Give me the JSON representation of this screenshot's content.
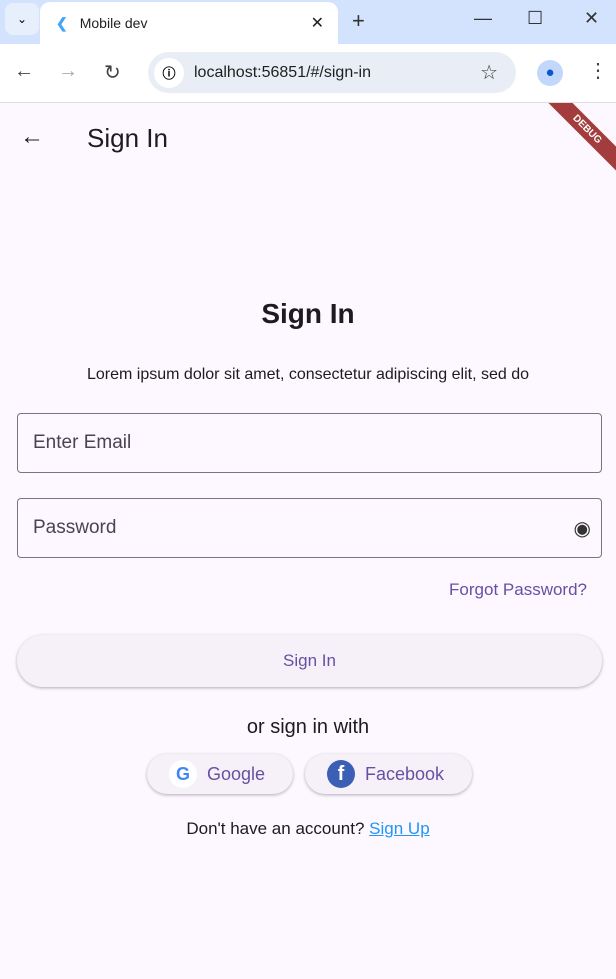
{
  "browser": {
    "tab_title": "Mobile dev",
    "url": "localhost:56851/#/sign-in"
  },
  "appbar": {
    "title": "Sign In",
    "debug_banner": "DEBUG"
  },
  "form": {
    "heading": "Sign In",
    "description": "Lorem ipsum dolor sit amet, consectetur adipiscing elit, sed do",
    "email_placeholder": "Enter Email",
    "password_placeholder": "Password",
    "forgot_label": "Forgot Password?",
    "signin_label": "Sign In",
    "or_label": "or sign in with",
    "google_label": "Google",
    "facebook_label": "Facebook",
    "no_account": "Don't have an account?",
    "signup_label": "Sign Up"
  },
  "colors": {
    "primary": "#6750a4",
    "link": "#2196f3",
    "background": "#fdf7ff"
  }
}
